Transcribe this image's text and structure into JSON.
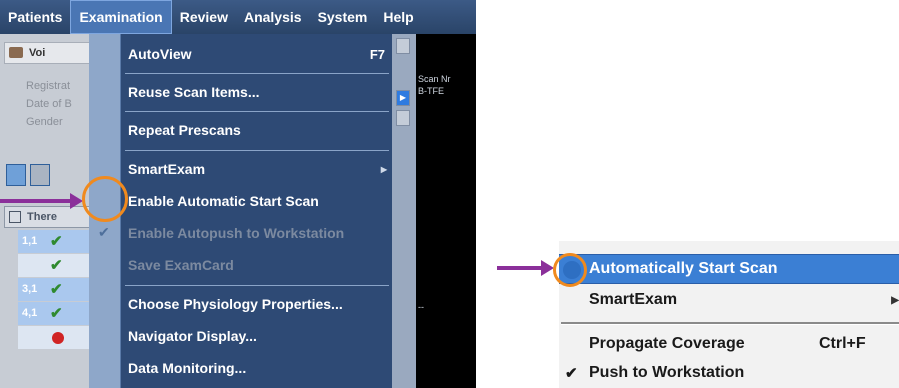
{
  "menubar": {
    "items": [
      {
        "label": "Patients",
        "active": false
      },
      {
        "label": "Examination",
        "active": true
      },
      {
        "label": "Review",
        "active": false
      },
      {
        "label": "Analysis",
        "active": false
      },
      {
        "label": "System",
        "active": false
      },
      {
        "label": "Help",
        "active": false
      }
    ]
  },
  "examination_menu": {
    "items": [
      {
        "label": "AutoView",
        "shortcut": "F7",
        "enabled": true
      },
      {
        "label": "Reuse Scan Items...",
        "enabled": true
      },
      {
        "label": "Repeat Prescans",
        "enabled": true
      },
      {
        "label": "SmartExam",
        "enabled": true,
        "has_submenu": true
      },
      {
        "label": "Enable Automatic Start Scan",
        "enabled": true,
        "checked": false
      },
      {
        "label": "Enable Autopush to Workstation",
        "enabled": false,
        "checked": true
      },
      {
        "label": "Save ExamCard",
        "enabled": false
      },
      {
        "label": "Choose Physiology Properties...",
        "enabled": true
      },
      {
        "label": "Navigator Display...",
        "enabled": true
      },
      {
        "label": "Data Monitoring...",
        "enabled": true
      }
    ]
  },
  "patient_panel": {
    "title": "Voi",
    "fields": [
      "Registrat",
      "Date of B",
      "Gender"
    ],
    "list_header": "There",
    "rows": [
      {
        "label": "1,1",
        "status": "ok"
      },
      {
        "label": "",
        "status": "ok"
      },
      {
        "label": "3,1",
        "status": "ok"
      },
      {
        "label": "4,1",
        "status": "ok"
      },
      {
        "label": "",
        "status": "error"
      }
    ]
  },
  "viewer": {
    "scan_nr": "Scan Nr",
    "sequence": "B-TFE",
    "marker": "--"
  },
  "zoom_menu": {
    "items": [
      {
        "label": "Automatically Start Scan",
        "highlighted": true
      },
      {
        "label": "SmartExam",
        "has_submenu": true
      },
      {
        "label": "Propagate Coverage",
        "shortcut": "Ctrl+F"
      },
      {
        "label": "Push to Workstation",
        "checked": true
      }
    ]
  },
  "colors": {
    "annotation_arrow": "#8b2f9a",
    "annotation_circle": "#f08a1e",
    "menu_background": "#2e4a75",
    "highlight": "#3b7fd4"
  }
}
